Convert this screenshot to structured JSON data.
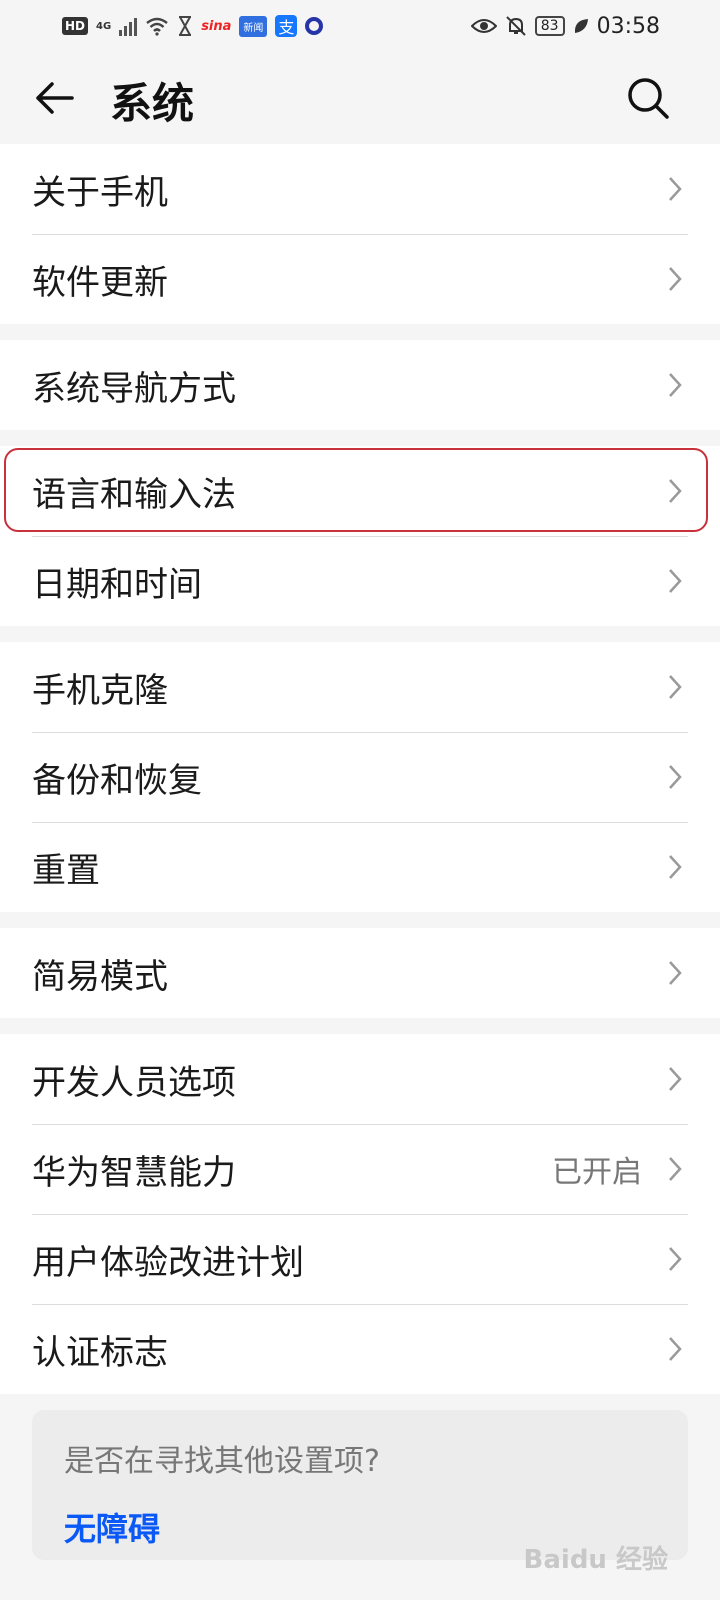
{
  "status_bar": {
    "hd": "HD",
    "network": "4G",
    "sina": "sina",
    "app_blue": "新闻",
    "alipay": "支",
    "battery": "83",
    "time": "03:58"
  },
  "header": {
    "title": "系统",
    "back_icon": "arrow-left-icon",
    "search_icon": "search-icon"
  },
  "groups": [
    {
      "items": [
        {
          "label": "关于手机"
        },
        {
          "label": "软件更新"
        }
      ]
    },
    {
      "items": [
        {
          "label": "系统导航方式"
        }
      ]
    },
    {
      "items": [
        {
          "label": "语言和输入法"
        },
        {
          "label": "日期和时间"
        }
      ]
    },
    {
      "items": [
        {
          "label": "手机克隆"
        },
        {
          "label": "备份和恢复"
        },
        {
          "label": "重置"
        }
      ]
    },
    {
      "items": [
        {
          "label": "简易模式"
        }
      ]
    },
    {
      "items": [
        {
          "label": "开发人员选项"
        },
        {
          "label": "华为智慧能力",
          "value": "已开启"
        },
        {
          "label": "用户体验改进计划"
        },
        {
          "label": "认证标志"
        }
      ]
    }
  ],
  "suggestion": {
    "question": "是否在寻找其他设置项?",
    "link": "无障碍"
  },
  "watermark": "Baidu 经验",
  "colors": {
    "highlight": "#c8323c",
    "link": "#0a59f7"
  }
}
